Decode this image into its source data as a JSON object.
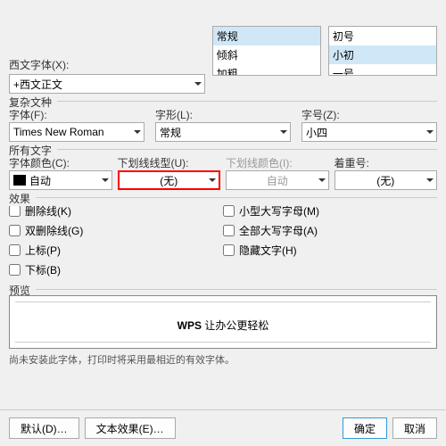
{
  "top": {
    "westernFontLabel": "西文字体(X):",
    "westernFontValue": "+西文正文",
    "styleList": [
      "常规",
      "倾斜",
      "加粗"
    ],
    "styleSelected": "常规",
    "sizeList": [
      "初号",
      "小初",
      "一号"
    ],
    "sizeSelected": "小初"
  },
  "complex": {
    "title": "复杂文种",
    "fontLabel": "字体(F):",
    "fontValue": "Times New Roman",
    "styleLabel": "字形(L):",
    "styleValue": "常规",
    "sizeLabel": "字号(Z):",
    "sizeValue": "小四"
  },
  "allText": {
    "title": "所有文字",
    "fontColorLabel": "字体颜色(C):",
    "fontColorValue": "自动",
    "underlineLabel": "下划线线型(U):",
    "underlineValue": "(无)",
    "underlineColorLabel": "下划线颜色(I):",
    "underlineColorValue": "自动",
    "emphasisLabel": "着重号:",
    "emphasisValue": "(无)"
  },
  "effects": {
    "title": "效果",
    "strike": "删除线(K)",
    "dblStrike": "双删除线(G)",
    "superscript": "上标(P)",
    "subscript": "下标(B)",
    "smallCaps": "小型大写字母(M)",
    "allCaps": "全部大写字母(A)",
    "hidden": "隐藏文字(H)"
  },
  "preview": {
    "title": "预览",
    "textBold": "WPS ",
    "textNormal": "让办公更轻松",
    "note": "尚未安装此字体，打印时将采用最相近的有效字体。"
  },
  "footer": {
    "default": "默认(D)…",
    "textEffect": "文本效果(E)…",
    "ok": "确定",
    "cancel": "取消"
  }
}
